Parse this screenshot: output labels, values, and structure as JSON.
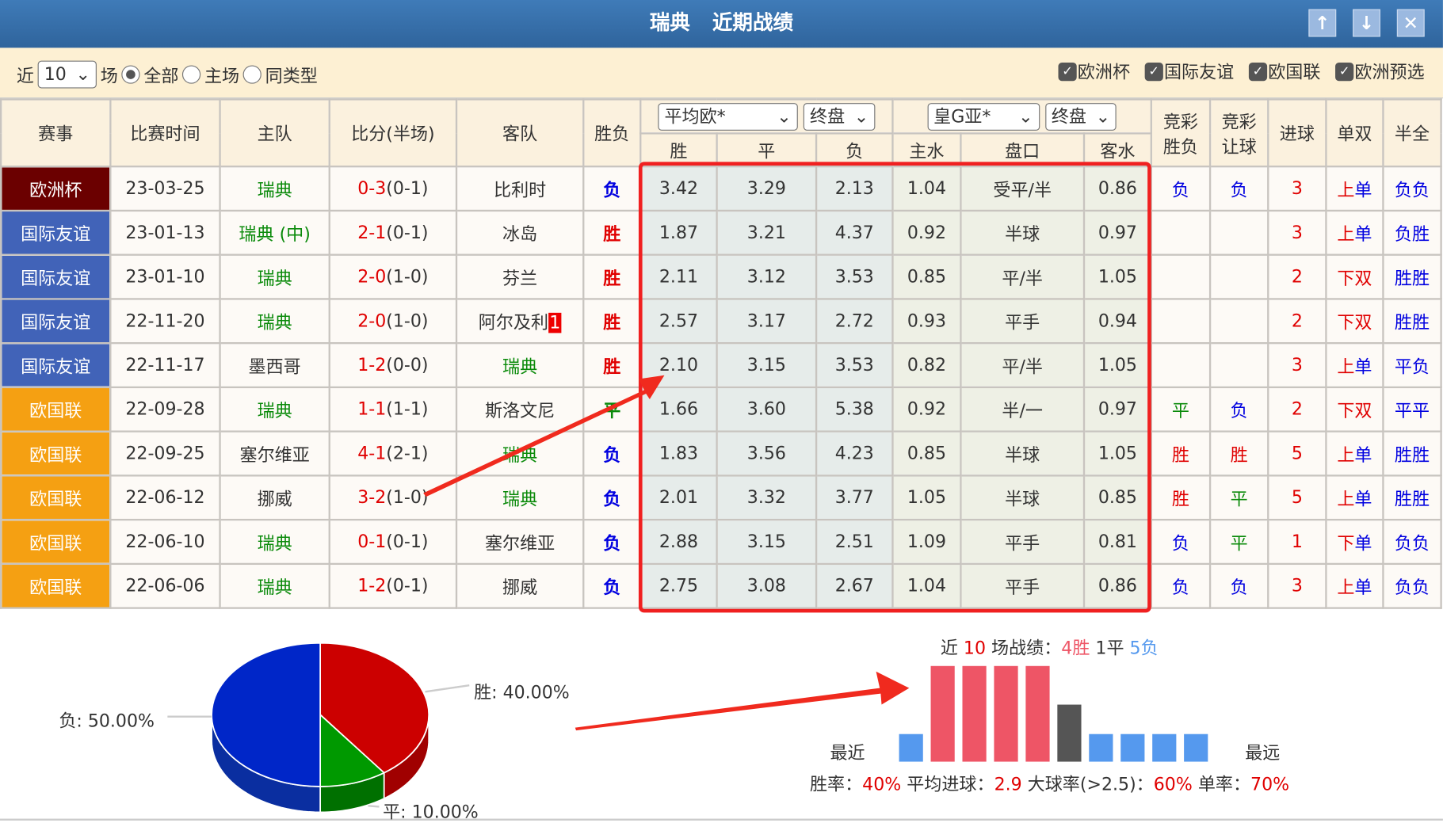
{
  "title": {
    "team": "瑞典",
    "text": "近期战绩"
  },
  "window_buttons": {
    "up": "↑",
    "down": "↓",
    "close": "✕"
  },
  "filter": {
    "prefix": "近",
    "count": "10",
    "suffix": "场",
    "radios": [
      {
        "label": "全部",
        "checked": true
      },
      {
        "label": "主场",
        "checked": false
      },
      {
        "label": "同类型",
        "checked": false
      }
    ],
    "checkboxes": [
      {
        "label": "欧洲杯",
        "checked": true
      },
      {
        "label": "国际友谊",
        "checked": true
      },
      {
        "label": "欧国联",
        "checked": true
      },
      {
        "label": "欧洲预选",
        "checked": true
      }
    ]
  },
  "headers": {
    "event": "赛事",
    "time": "比赛时间",
    "home": "主队",
    "score": "比分(半场)",
    "away": "客队",
    "result": "胜负",
    "euro_company": "平均欧*",
    "euro_stage": "终盘",
    "asia_company": "皇G亚*",
    "asia_stage": "终盘",
    "jc_result": "竞彩胜负",
    "jc_handicap": "竞彩让球",
    "goals": "进球",
    "oddeven": "单双",
    "htft": "半全",
    "euro_sub": [
      "胜",
      "平",
      "负"
    ],
    "asia_sub": [
      "主水",
      "盘口",
      "客水"
    ]
  },
  "rows": [
    {
      "event": "欧洲杯",
      "event_color": "#6b0000",
      "time": "23-03-25",
      "home": "瑞典",
      "home_c": "green",
      "score": "0-3",
      "half": "(0-1)",
      "away": "比利时",
      "away_c": "dark",
      "away_tag": "",
      "result": "负",
      "result_c": "blue",
      "w": "3.42",
      "d": "3.29",
      "l": "2.13",
      "hw": "1.04",
      "hc": "受平/半",
      "aw": "0.86",
      "jr": "负",
      "jr_c": "blue",
      "jh": "负",
      "jh_c": "blue",
      "goals": "3",
      "ou": "上",
      "oe": "单",
      "oe_c": "blue",
      "ou_c": "red",
      "htft": "负负"
    },
    {
      "event": "国际友谊",
      "event_color": "#4163b8",
      "time": "23-01-13",
      "home": "瑞典 (中)",
      "home_c": "green",
      "score": "2-1",
      "half": "(0-1)",
      "away": "冰岛",
      "away_c": "dark",
      "away_tag": "",
      "result": "胜",
      "result_c": "red",
      "w": "1.87",
      "d": "3.21",
      "l": "4.37",
      "hw": "0.92",
      "hc": "半球",
      "aw": "0.97",
      "jr": "",
      "jr_c": "blue",
      "jh": "",
      "jh_c": "blue",
      "goals": "3",
      "ou": "上",
      "oe": "单",
      "oe_c": "blue",
      "ou_c": "red",
      "htft": "负胜"
    },
    {
      "event": "国际友谊",
      "event_color": "#4163b8",
      "time": "23-01-10",
      "home": "瑞典",
      "home_c": "green",
      "score": "2-0",
      "half": "(1-0)",
      "away": "芬兰",
      "away_c": "dark",
      "away_tag": "",
      "result": "胜",
      "result_c": "red",
      "w": "2.11",
      "d": "3.12",
      "l": "3.53",
      "hw": "0.85",
      "hc": "平/半",
      "aw": "1.05",
      "jr": "",
      "jr_c": "blue",
      "jh": "",
      "jh_c": "blue",
      "goals": "2",
      "ou": "下",
      "oe": "双",
      "oe_c": "red",
      "ou_c": "red",
      "htft": "胜胜"
    },
    {
      "event": "国际友谊",
      "event_color": "#4163b8",
      "time": "22-11-20",
      "home": "瑞典",
      "home_c": "green",
      "score": "2-0",
      "half": "(1-0)",
      "away": "阿尔及利",
      "away_c": "dark",
      "away_tag": "1",
      "result": "胜",
      "result_c": "red",
      "w": "2.57",
      "d": "3.17",
      "l": "2.72",
      "hw": "0.93",
      "hc": "平手",
      "aw": "0.94",
      "jr": "",
      "jr_c": "blue",
      "jh": "",
      "jh_c": "blue",
      "goals": "2",
      "ou": "下",
      "oe": "双",
      "oe_c": "red",
      "ou_c": "red",
      "htft": "胜胜"
    },
    {
      "event": "国际友谊",
      "event_color": "#4163b8",
      "time": "22-11-17",
      "home": "墨西哥",
      "home_c": "dark",
      "score": "1-2",
      "half": "(0-0)",
      "away": "瑞典",
      "away_c": "green",
      "away_tag": "",
      "result": "胜",
      "result_c": "red",
      "w": "2.10",
      "d": "3.15",
      "l": "3.53",
      "hw": "0.82",
      "hc": "平/半",
      "aw": "1.05",
      "jr": "",
      "jr_c": "blue",
      "jh": "",
      "jh_c": "blue",
      "goals": "3",
      "ou": "上",
      "oe": "单",
      "oe_c": "blue",
      "ou_c": "red",
      "htft": "平负"
    },
    {
      "event": "欧国联",
      "event_color": "#f5a012",
      "time": "22-09-28",
      "home": "瑞典",
      "home_c": "green",
      "score": "1-1",
      "half": "(1-1)",
      "away": "斯洛文尼",
      "away_c": "dark",
      "away_tag": "",
      "result": "平",
      "result_c": "green",
      "w": "1.66",
      "d": "3.60",
      "l": "5.38",
      "hw": "0.92",
      "hc": "半/一",
      "aw": "0.97",
      "jr": "平",
      "jr_c": "green",
      "jh": "负",
      "jh_c": "blue",
      "goals": "2",
      "ou": "下",
      "oe": "双",
      "oe_c": "red",
      "ou_c": "red",
      "htft": "平平"
    },
    {
      "event": "欧国联",
      "event_color": "#f5a012",
      "time": "22-09-25",
      "home": "塞尔维亚",
      "home_c": "dark",
      "score": "4-1",
      "half": "(2-1)",
      "away": "瑞典",
      "away_c": "green",
      "away_tag": "",
      "result": "负",
      "result_c": "blue",
      "w": "1.83",
      "d": "3.56",
      "l": "4.23",
      "hw": "0.85",
      "hc": "半球",
      "aw": "1.05",
      "jr": "胜",
      "jr_c": "red",
      "jh": "胜",
      "jh_c": "red",
      "goals": "5",
      "ou": "上",
      "oe": "单",
      "oe_c": "blue",
      "ou_c": "red",
      "htft": "胜胜"
    },
    {
      "event": "欧国联",
      "event_color": "#f5a012",
      "time": "22-06-12",
      "home": "挪威",
      "home_c": "dark",
      "score": "3-2",
      "half": "(1-0)",
      "away": "瑞典",
      "away_c": "green",
      "away_tag": "",
      "result": "负",
      "result_c": "blue",
      "w": "2.01",
      "d": "3.32",
      "l": "3.77",
      "hw": "1.05",
      "hc": "半球",
      "aw": "0.85",
      "jr": "胜",
      "jr_c": "red",
      "jh": "平",
      "jh_c": "green",
      "goals": "5",
      "ou": "上",
      "oe": "单",
      "oe_c": "blue",
      "ou_c": "red",
      "htft": "胜胜"
    },
    {
      "event": "欧国联",
      "event_color": "#f5a012",
      "time": "22-06-10",
      "home": "瑞典",
      "home_c": "green",
      "score": "0-1",
      "half": "(0-1)",
      "away": "塞尔维亚",
      "away_c": "dark",
      "away_tag": "",
      "result": "负",
      "result_c": "blue",
      "w": "2.88",
      "d": "3.15",
      "l": "2.51",
      "hw": "1.09",
      "hc": "平手",
      "aw": "0.81",
      "jr": "负",
      "jr_c": "blue",
      "jh": "平",
      "jh_c": "green",
      "goals": "1",
      "ou": "下",
      "oe": "单",
      "oe_c": "blue",
      "ou_c": "red",
      "htft": "负负"
    },
    {
      "event": "欧国联",
      "event_color": "#f5a012",
      "time": "22-06-06",
      "home": "瑞典",
      "home_c": "green",
      "score": "1-2",
      "half": "(0-1)",
      "away": "挪威",
      "away_c": "dark",
      "away_tag": "",
      "result": "负",
      "result_c": "blue",
      "w": "2.75",
      "d": "3.08",
      "l": "2.67",
      "hw": "1.04",
      "hc": "平手",
      "aw": "0.86",
      "jr": "负",
      "jr_c": "blue",
      "jh": "负",
      "jh_c": "blue",
      "goals": "3",
      "ou": "上",
      "oe": "单",
      "oe_c": "blue",
      "ou_c": "red",
      "htft": "负负"
    }
  ],
  "pie": {
    "slices": [
      {
        "label": "胜",
        "text": "胜: 40.00%",
        "value": 40,
        "color": "#cc0000"
      },
      {
        "label": "平",
        "text": "平: 10.00%",
        "value": 10,
        "color": "#009900"
      },
      {
        "label": "负",
        "text": "负: 50.00%",
        "value": 50,
        "color": "#0026c8"
      }
    ]
  },
  "summary": {
    "p1": "近 ",
    "n": "10",
    "p2": " 场战绩：",
    "win": "4胜",
    "draw": " 1平 ",
    "loss": "5负",
    "recent": "最近",
    "far": "最远",
    "results": [
      "负",
      "胜",
      "胜",
      "胜",
      "胜",
      "平",
      "负",
      "负",
      "负",
      "负"
    ],
    "colors": {
      "胜": "#ee5566",
      "平": "#555555",
      "负": "#5599ee"
    },
    "stats": [
      {
        "label": "胜率：",
        "value": "40%"
      },
      {
        "label": "平均进球：",
        "value": "2.9"
      },
      {
        "label": "大球率(>2.5)：",
        "value": "60%"
      },
      {
        "label": "单率：",
        "value": "70%"
      }
    ]
  }
}
